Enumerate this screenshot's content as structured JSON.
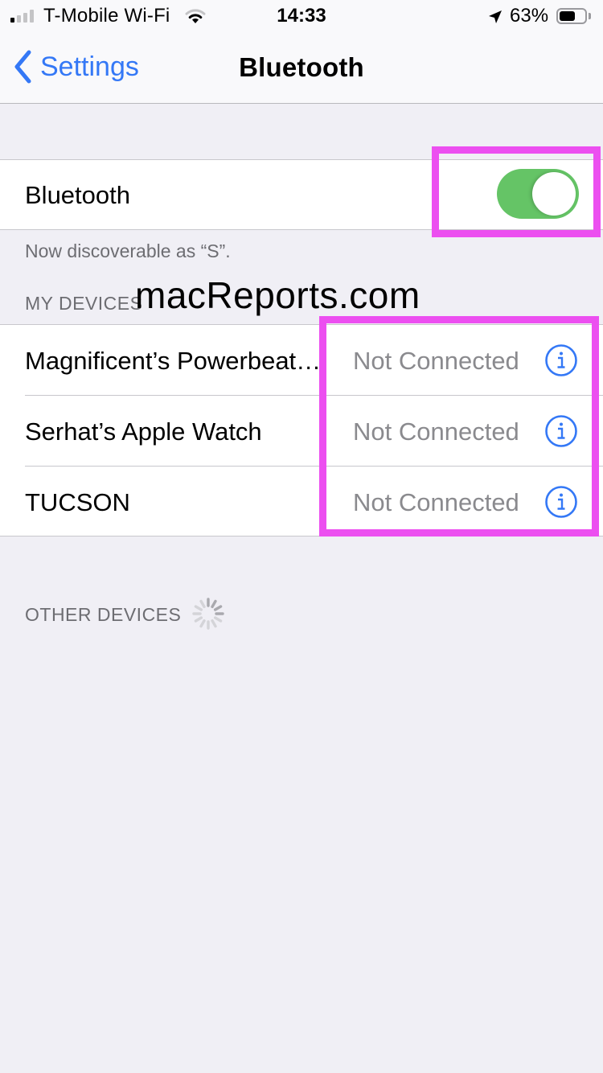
{
  "status_bar": {
    "signal_bars_active": 1,
    "signal_bars_total": 4,
    "carrier": "T-Mobile Wi-Fi",
    "wifi_icon": "wifi-icon",
    "time": "14:33",
    "location_icon": "location-arrow-icon",
    "battery_percent_label": "63%",
    "battery_level": 0.63
  },
  "nav": {
    "back_label": "Settings",
    "back_icon": "chevron-left-icon",
    "title": "Bluetooth"
  },
  "bluetooth": {
    "label": "Bluetooth",
    "enabled": true,
    "toggle_color": "#65c466",
    "discoverable_note": "Now discoverable as “S”."
  },
  "my_devices": {
    "header": "MY DEVICES",
    "items": [
      {
        "name": "Magnificent’s Powerbeat…",
        "status": "Not Connected",
        "icon": "info-icon"
      },
      {
        "name": "Serhat’s Apple Watch",
        "status": "Not Connected",
        "icon": "info-icon"
      },
      {
        "name": "TUCSON",
        "status": "Not Connected",
        "icon": "info-icon"
      }
    ]
  },
  "other_devices": {
    "header": "OTHER DEVICES",
    "loading_icon": "spinner-icon"
  },
  "overlay": {
    "watermark": "macReports.com",
    "highlight_color": "#ec4ff0"
  },
  "colors": {
    "accent": "#3478f6",
    "background": "#f0eff5",
    "secondary_text": "#6d6d72",
    "status_text": "#8a8a8e"
  }
}
